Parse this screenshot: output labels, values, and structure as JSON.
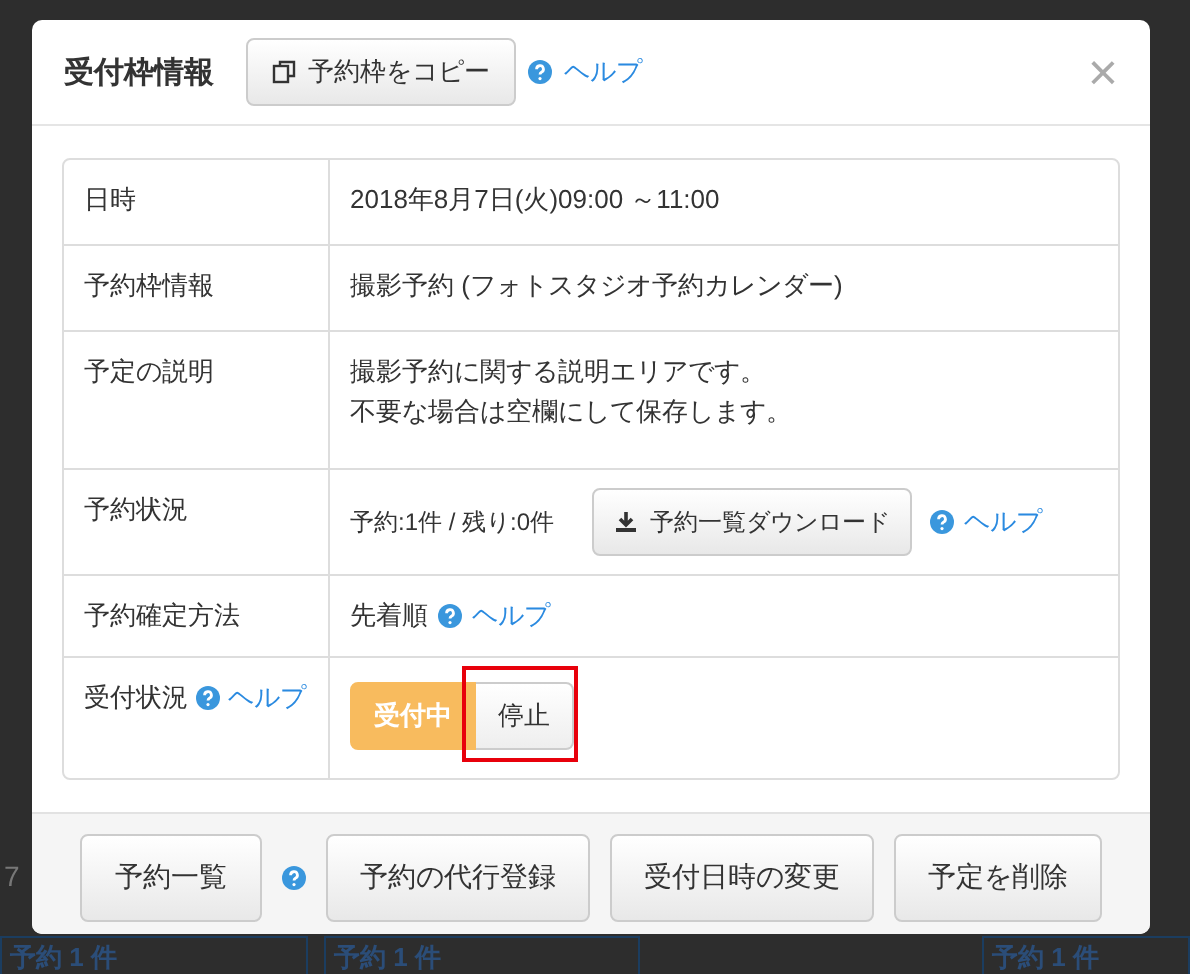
{
  "background": {
    "cells": [
      {
        "line2": "予約 1 件"
      },
      {
        "line2": "予約 1 件"
      },
      {
        "line2": "予約 1 件"
      }
    ],
    "day": "7"
  },
  "modal": {
    "title": "受付枠情報",
    "copy_button": "予約枠をコピー",
    "help": "ヘルプ",
    "close": "×",
    "rows": [
      {
        "label": "日時",
        "kind": "text",
        "lines": [
          "2018年8月7日(火)09:00 ～11:00"
        ]
      },
      {
        "label": "予約枠情報",
        "kind": "text",
        "lines": [
          "撮影予約 (フォトスタジオ予約カレンダー)"
        ]
      },
      {
        "label": "予定の説明",
        "kind": "text",
        "lines": [
          "撮影予約に関する説明エリアです。",
          "不要な場合は空欄にして保存します。"
        ]
      },
      {
        "label": "予約状況",
        "kind": "download",
        "text": "予約:1件 / 残り:0件",
        "button": "予約一覧ダウンロード",
        "help": "ヘルプ"
      },
      {
        "label": "予約確定方法",
        "kind": "method",
        "text": "先着順",
        "help": "ヘルプ"
      },
      {
        "label": "受付状況",
        "label_help": "ヘルプ",
        "kind": "toggle",
        "options": [
          {
            "label": "受付中",
            "selected": true
          },
          {
            "label": "停止",
            "selected": false,
            "highlighted": true
          }
        ]
      }
    ],
    "footer": [
      {
        "label": "予約一覧",
        "help_after": true
      },
      {
        "label": "予約の代行登録",
        "help_after": false
      },
      {
        "label": "受付日時の変更",
        "help_after": false
      },
      {
        "label": "予定を削除",
        "help_after": false
      }
    ]
  }
}
